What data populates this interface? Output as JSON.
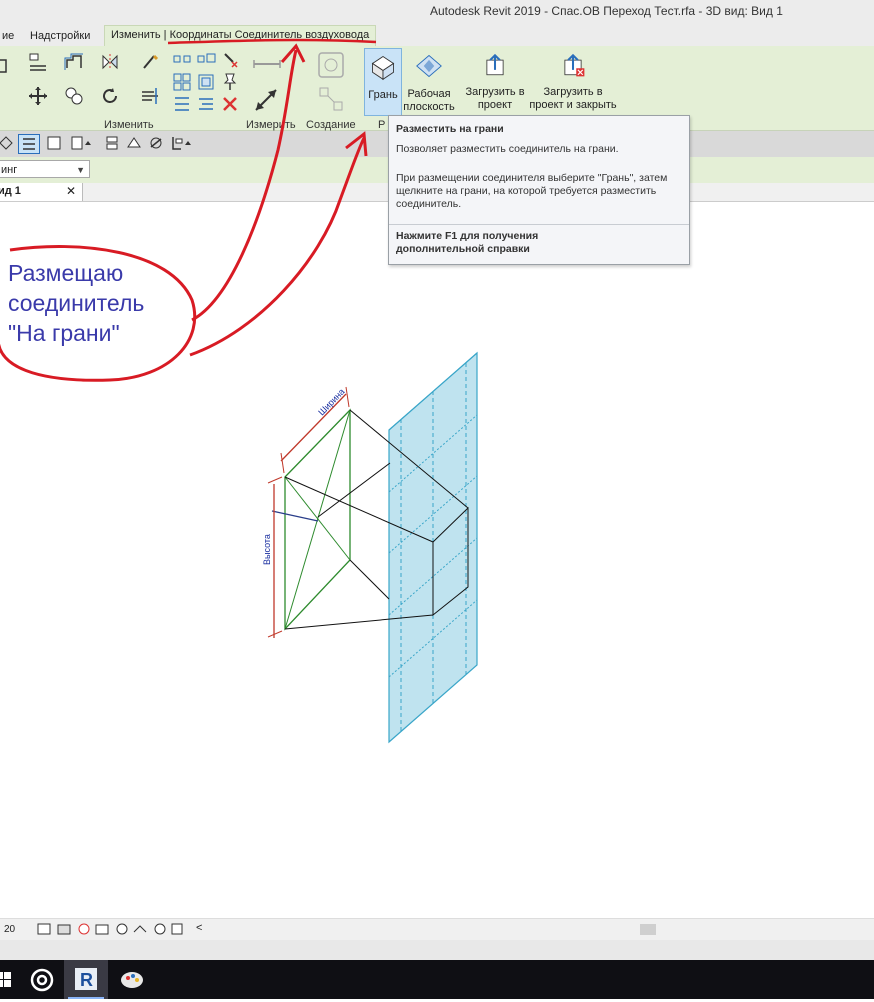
{
  "window": {
    "title": "Autodesk Revit 2019 - Спас.ОВ Переход Тест.rfa - 3D вид: Вид 1"
  },
  "ribbon_tabs": [
    {
      "label": "ие"
    },
    {
      "label": "Надстройки"
    },
    {
      "label": "Изменить | Координаты Соединитель воздуховода"
    }
  ],
  "ribbon": {
    "panels": {
      "modify": "Изменить",
      "measure": "Измерить",
      "create": "Создание",
      "placement": "Р"
    },
    "buttons": {
      "face": "Грань",
      "work_plane": "Рабочая плоскость",
      "load_into_project": "Загрузить в проект",
      "load_into_project_close": "Загрузить в проект и закрыть"
    }
  },
  "properties_bar": {
    "type_selector_value": "инг"
  },
  "view_tab": {
    "label": "ид 1",
    "close": "✕"
  },
  "tooltip": {
    "title": "Разместить на грани",
    "description": "Позволяет разместить соединитель на грани.",
    "detail": "При размещении соединителя выберите \"Грань\", затем щелкните на грани, на которой требуется разместить соединитель.",
    "help": "Нажмите F1 для получения дополнительной справки"
  },
  "annotation": {
    "lines": [
      "Размещаю",
      "соединитель",
      "\"На грани\""
    ],
    "color": "#3a3aaa",
    "marker_color": "#d81b24"
  },
  "model": {
    "width_label": "Ширина",
    "height_label": "Высота",
    "face_color": "#bfe3ef",
    "face_edge_color": "#3aa6c9"
  },
  "status_bar": {
    "scale": "20",
    "scroll_left": "<"
  },
  "colors": {
    "ribbon_bg": "#e4efd6",
    "active_button": "#c9e3f7",
    "taskbar": "#0f0f14"
  },
  "taskbar_items": [
    {
      "icon": "windows-start-icon"
    },
    {
      "icon": "cortana-icon"
    },
    {
      "icon": "revit-app-icon"
    },
    {
      "icon": "paint-app-icon"
    }
  ]
}
